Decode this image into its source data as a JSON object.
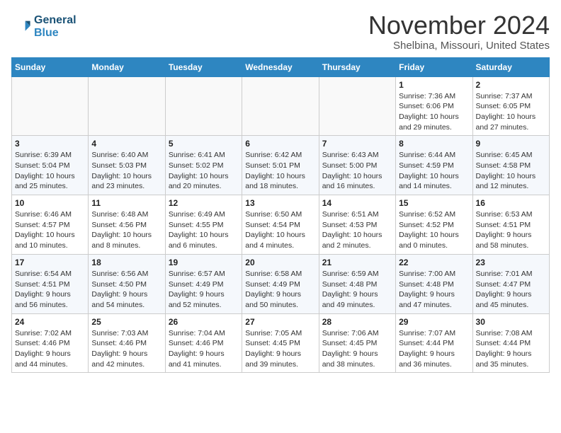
{
  "header": {
    "logo_line1": "General",
    "logo_line2": "Blue",
    "month": "November 2024",
    "location": "Shelbina, Missouri, United States"
  },
  "weekdays": [
    "Sunday",
    "Monday",
    "Tuesday",
    "Wednesday",
    "Thursday",
    "Friday",
    "Saturday"
  ],
  "weeks": [
    [
      {
        "day": "",
        "info": ""
      },
      {
        "day": "",
        "info": ""
      },
      {
        "day": "",
        "info": ""
      },
      {
        "day": "",
        "info": ""
      },
      {
        "day": "",
        "info": ""
      },
      {
        "day": "1",
        "info": "Sunrise: 7:36 AM\nSunset: 6:06 PM\nDaylight: 10 hours\nand 29 minutes."
      },
      {
        "day": "2",
        "info": "Sunrise: 7:37 AM\nSunset: 6:05 PM\nDaylight: 10 hours\nand 27 minutes."
      }
    ],
    [
      {
        "day": "3",
        "info": "Sunrise: 6:39 AM\nSunset: 5:04 PM\nDaylight: 10 hours\nand 25 minutes."
      },
      {
        "day": "4",
        "info": "Sunrise: 6:40 AM\nSunset: 5:03 PM\nDaylight: 10 hours\nand 23 minutes."
      },
      {
        "day": "5",
        "info": "Sunrise: 6:41 AM\nSunset: 5:02 PM\nDaylight: 10 hours\nand 20 minutes."
      },
      {
        "day": "6",
        "info": "Sunrise: 6:42 AM\nSunset: 5:01 PM\nDaylight: 10 hours\nand 18 minutes."
      },
      {
        "day": "7",
        "info": "Sunrise: 6:43 AM\nSunset: 5:00 PM\nDaylight: 10 hours\nand 16 minutes."
      },
      {
        "day": "8",
        "info": "Sunrise: 6:44 AM\nSunset: 4:59 PM\nDaylight: 10 hours\nand 14 minutes."
      },
      {
        "day": "9",
        "info": "Sunrise: 6:45 AM\nSunset: 4:58 PM\nDaylight: 10 hours\nand 12 minutes."
      }
    ],
    [
      {
        "day": "10",
        "info": "Sunrise: 6:46 AM\nSunset: 4:57 PM\nDaylight: 10 hours\nand 10 minutes."
      },
      {
        "day": "11",
        "info": "Sunrise: 6:48 AM\nSunset: 4:56 PM\nDaylight: 10 hours\nand 8 minutes."
      },
      {
        "day": "12",
        "info": "Sunrise: 6:49 AM\nSunset: 4:55 PM\nDaylight: 10 hours\nand 6 minutes."
      },
      {
        "day": "13",
        "info": "Sunrise: 6:50 AM\nSunset: 4:54 PM\nDaylight: 10 hours\nand 4 minutes."
      },
      {
        "day": "14",
        "info": "Sunrise: 6:51 AM\nSunset: 4:53 PM\nDaylight: 10 hours\nand 2 minutes."
      },
      {
        "day": "15",
        "info": "Sunrise: 6:52 AM\nSunset: 4:52 PM\nDaylight: 10 hours\nand 0 minutes."
      },
      {
        "day": "16",
        "info": "Sunrise: 6:53 AM\nSunset: 4:51 PM\nDaylight: 9 hours\nand 58 minutes."
      }
    ],
    [
      {
        "day": "17",
        "info": "Sunrise: 6:54 AM\nSunset: 4:51 PM\nDaylight: 9 hours\nand 56 minutes."
      },
      {
        "day": "18",
        "info": "Sunrise: 6:56 AM\nSunset: 4:50 PM\nDaylight: 9 hours\nand 54 minutes."
      },
      {
        "day": "19",
        "info": "Sunrise: 6:57 AM\nSunset: 4:49 PM\nDaylight: 9 hours\nand 52 minutes."
      },
      {
        "day": "20",
        "info": "Sunrise: 6:58 AM\nSunset: 4:49 PM\nDaylight: 9 hours\nand 50 minutes."
      },
      {
        "day": "21",
        "info": "Sunrise: 6:59 AM\nSunset: 4:48 PM\nDaylight: 9 hours\nand 49 minutes."
      },
      {
        "day": "22",
        "info": "Sunrise: 7:00 AM\nSunset: 4:48 PM\nDaylight: 9 hours\nand 47 minutes."
      },
      {
        "day": "23",
        "info": "Sunrise: 7:01 AM\nSunset: 4:47 PM\nDaylight: 9 hours\nand 45 minutes."
      }
    ],
    [
      {
        "day": "24",
        "info": "Sunrise: 7:02 AM\nSunset: 4:46 PM\nDaylight: 9 hours\nand 44 minutes."
      },
      {
        "day": "25",
        "info": "Sunrise: 7:03 AM\nSunset: 4:46 PM\nDaylight: 9 hours\nand 42 minutes."
      },
      {
        "day": "26",
        "info": "Sunrise: 7:04 AM\nSunset: 4:46 PM\nDaylight: 9 hours\nand 41 minutes."
      },
      {
        "day": "27",
        "info": "Sunrise: 7:05 AM\nSunset: 4:45 PM\nDaylight: 9 hours\nand 39 minutes."
      },
      {
        "day": "28",
        "info": "Sunrise: 7:06 AM\nSunset: 4:45 PM\nDaylight: 9 hours\nand 38 minutes."
      },
      {
        "day": "29",
        "info": "Sunrise: 7:07 AM\nSunset: 4:44 PM\nDaylight: 9 hours\nand 36 minutes."
      },
      {
        "day": "30",
        "info": "Sunrise: 7:08 AM\nSunset: 4:44 PM\nDaylight: 9 hours\nand 35 minutes."
      }
    ]
  ]
}
